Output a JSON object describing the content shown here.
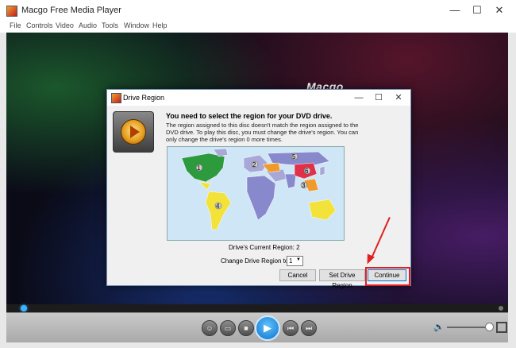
{
  "window": {
    "title": "Macgo Free Media Player"
  },
  "menu": [
    "File",
    "Controls",
    "Video",
    "Audio",
    "Tools",
    "Window",
    "Help"
  ],
  "video": {
    "brand": "Macgo"
  },
  "dialog": {
    "title": "Drive Region",
    "heading": "You need to select the region for your DVD drive.",
    "message": "The region assigned to this disc doesn't match the region assigned to the DVD drive. To play this disc, you must change the drive's region. You can only change the drive's region 0 more times.",
    "map_region_numbers": [
      "1",
      "2",
      "3",
      "4",
      "5",
      "6"
    ],
    "current_region": "Drive's Current Region: 2",
    "change_label": "Change Drive Region to:",
    "selected_region": "1",
    "buttons": {
      "cancel": "Cancel",
      "set": "Set Drive Region",
      "continue": "Continue"
    }
  },
  "colors": {
    "region1": "#2e9a3e",
    "region2": "#a8a8d8",
    "region3": "#f09a2a",
    "region4": "#f2e23a",
    "region5": "#8888cc",
    "region6": "#e0304a",
    "highlight": "#e02020",
    "play_button": "#1a8ae0"
  }
}
